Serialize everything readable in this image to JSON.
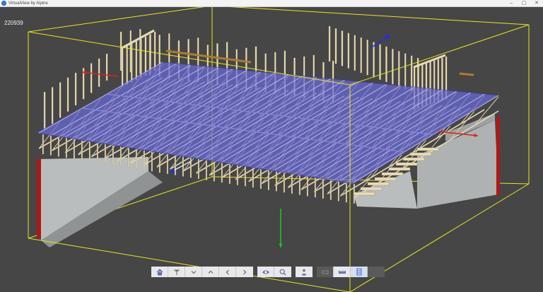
{
  "window": {
    "title": "VirtualView by Alpine",
    "controls": [
      "–",
      "▢",
      "✕"
    ]
  },
  "viewport": {
    "job_number": "220939"
  },
  "toolbar": {
    "groups": [
      [
        {
          "name": "home-icon"
        },
        {
          "name": "top-view-icon"
        },
        {
          "name": "chevron-down-icon"
        },
        {
          "name": "chevron-up-icon"
        },
        {
          "name": "chevron-left-icon"
        },
        {
          "name": "chevron-right-icon"
        }
      ],
      [
        {
          "name": "eye-icon"
        },
        {
          "name": "zoom-icon"
        }
      ],
      [
        {
          "name": "person-view-icon"
        }
      ],
      [
        {
          "name": "dim-icon"
        },
        {
          "name": "measure-icon"
        },
        {
          "name": "layers-icon"
        }
      ]
    ]
  },
  "colors": {
    "background": "#464646",
    "bounding_box": "#e6e61e",
    "floor_plane": "#6a6ad8",
    "lumber": "#e8dcb8",
    "foundation_wall": "#b9bdbd",
    "sill_red": "#b01818",
    "axis_x": "#e02020",
    "axis_y": "#20c020",
    "axis_z": "#2030e0"
  }
}
